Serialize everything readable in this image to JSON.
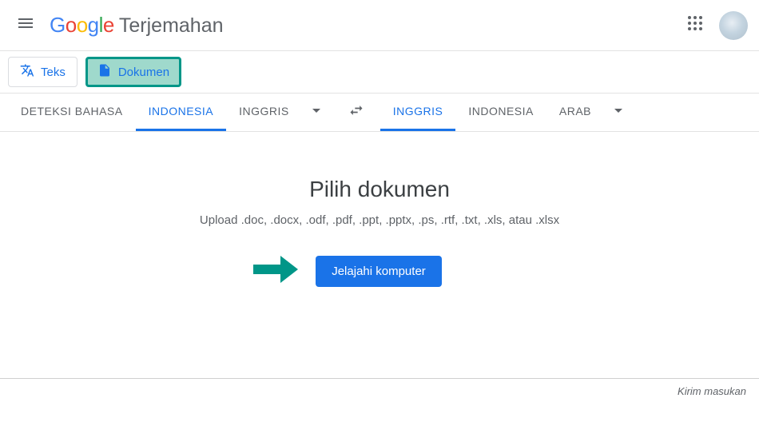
{
  "header": {
    "product_name": "Terjemahan"
  },
  "modes": {
    "text_label": "Teks",
    "document_label": "Dokumen"
  },
  "languages": {
    "source": {
      "detect": "DETEKSI BAHASA",
      "a": "INDONESIA",
      "b": "INGGRIS"
    },
    "target": {
      "a": "INGGRIS",
      "b": "INDONESIA",
      "c": "ARAB"
    }
  },
  "document": {
    "title": "Pilih dokumen",
    "subtitle": "Upload .doc, .docx, .odf, .pdf, .ppt, .pptx, .ps, .rtf, .txt, .xls, atau .xlsx",
    "browse_label": "Jelajahi komputer"
  },
  "footer": {
    "feedback": "Kirim masukan"
  },
  "annotation": {
    "arrow_color": "#009688"
  }
}
